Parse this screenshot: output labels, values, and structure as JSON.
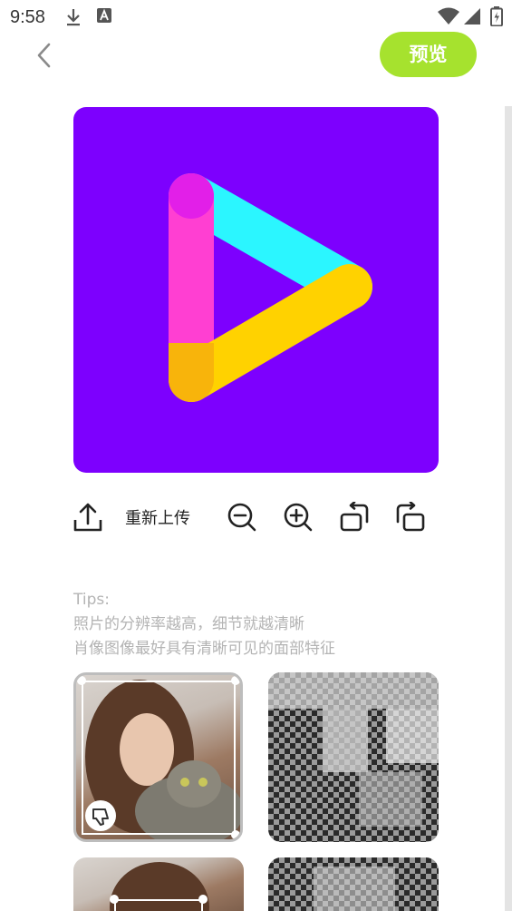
{
  "status_bar": {
    "time": "9:58",
    "icons": [
      "download-icon",
      "accessibility-icon",
      "wifi-icon",
      "cellular-signal-icon",
      "battery-icon"
    ]
  },
  "header": {
    "back_icon": "chevron-left-icon",
    "preview_label": "预览",
    "accent_color": "#a6e22e"
  },
  "main_image": {
    "background_color": "#7d00fe",
    "logo": "play-logo"
  },
  "toolbar": {
    "reupload_label": "重新上传",
    "icons": [
      "upload-icon",
      "zoom-out-icon",
      "zoom-in-icon",
      "rotate-left-icon",
      "rotate-right-icon"
    ]
  },
  "tips": {
    "heading": "Tips:",
    "line1": "照片的分辨率越高，细节就越清晰",
    "line2": "肖像图像最好具有清晰可见的面部特征"
  },
  "samples": {
    "items": [
      {
        "kind": "original-photo",
        "badge_icon": "thumbs-down-icon"
      },
      {
        "kind": "pixelated-result"
      },
      {
        "kind": "original-photo"
      },
      {
        "kind": "pixelated-result"
      }
    ]
  }
}
